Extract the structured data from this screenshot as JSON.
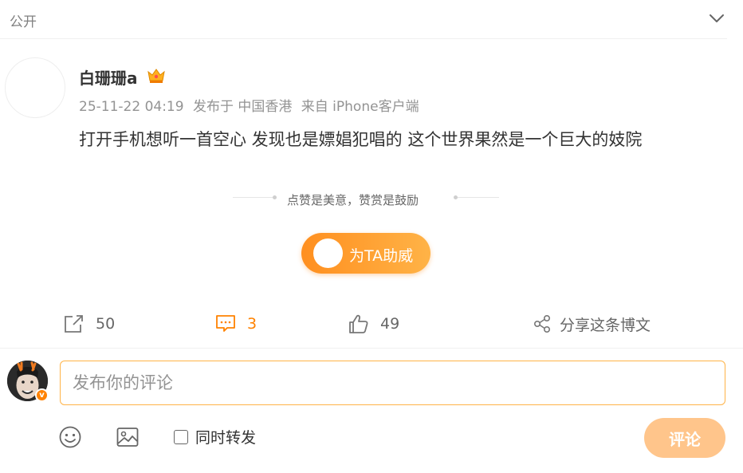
{
  "header": {
    "visibility": "公开",
    "expand_icon": "chevron-down-icon"
  },
  "post": {
    "author": "白珊珊a",
    "badge_icon": "crown-icon",
    "time": "25-11-22 04:19",
    "location": "发布于 中国香港",
    "source": "来自 iPhone客户端",
    "text": "打开手机想听一首空心 发现也是嫖娼犯唱的 这个世界果然是一个巨大的妓院"
  },
  "reward": {
    "slogan": "点赞是美意，赞赏是鼓励",
    "button_label": "为TA助威"
  },
  "actions": {
    "repost_count": "50",
    "comment_count": "3",
    "like_count": "49",
    "share_label": "分享这条博文"
  },
  "composer": {
    "placeholder": "发布你的评论",
    "forward_label": "同时转发",
    "submit_label": "评论",
    "badge_letter": "v"
  },
  "colors": {
    "accent": "#ff8200",
    "submit_disabled": "#ffc58b"
  }
}
